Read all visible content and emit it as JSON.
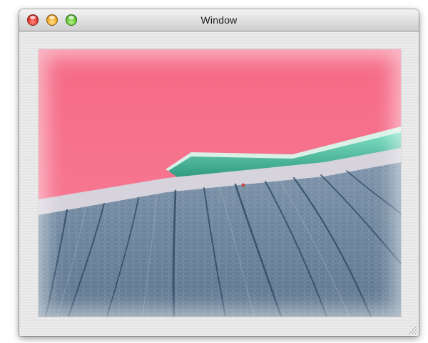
{
  "window": {
    "title": "Window"
  },
  "image": {
    "subject": "photo-rooftop-inverted-colors"
  },
  "icons": {
    "close": "close-button-icon",
    "minimize": "minimize-button-icon",
    "zoom": "zoom-button-icon",
    "resize": "resize-grip-icon"
  },
  "colors": {
    "close": "#e0322a",
    "minimize": "#f0a51c",
    "zoom": "#5bc22c",
    "sky": "#f7728a",
    "roof": "#6d87a0",
    "trim": "#52c8a4"
  }
}
